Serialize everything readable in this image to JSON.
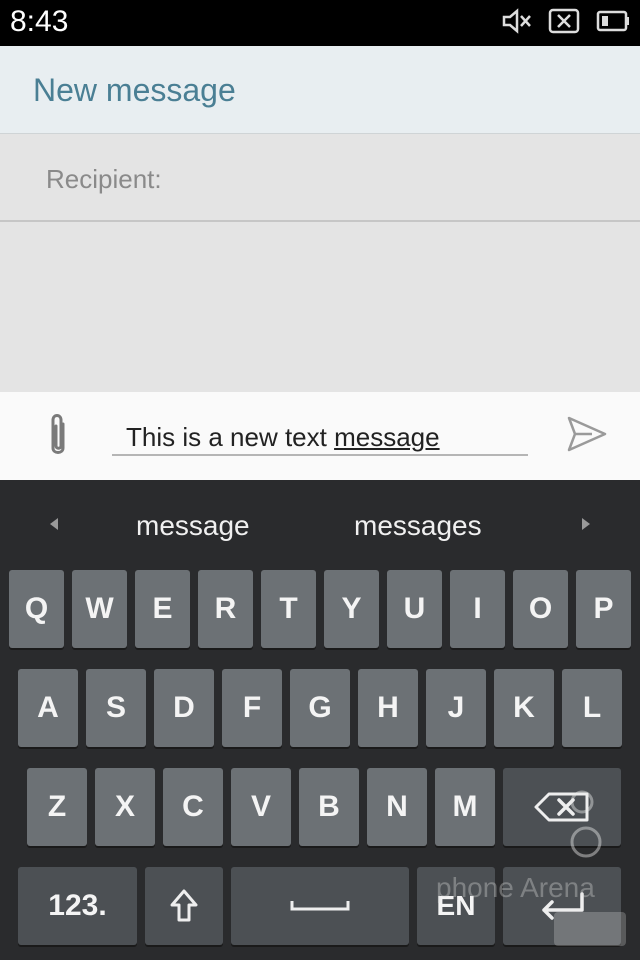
{
  "status_bar": {
    "time": "8:43",
    "icons": [
      "mute-icon",
      "no-signal-icon",
      "battery-icon"
    ]
  },
  "header": {
    "title": "New message"
  },
  "recipient": {
    "label": "Recipient:"
  },
  "compose": {
    "text_before": "This is a new text ",
    "text_underlined": "message",
    "attach_icon": "paperclip-icon",
    "send_icon": "send-icon"
  },
  "keyboard": {
    "suggestions": [
      "message",
      "messages"
    ],
    "row1": [
      "Q",
      "W",
      "E",
      "R",
      "T",
      "Y",
      "U",
      "I",
      "O",
      "P"
    ],
    "row2": [
      "A",
      "S",
      "D",
      "F",
      "G",
      "H",
      "J",
      "K",
      "L"
    ],
    "row3": [
      "Z",
      "X",
      "C",
      "V",
      "B",
      "N",
      "M"
    ],
    "bottom": {
      "numbers": "123.",
      "language": "EN"
    }
  },
  "watermark": {
    "text": "phone Arena"
  },
  "colors": {
    "header_bg": "#e8eef1",
    "title": "#4a7f94",
    "keyboard_bg": "#2a2b2d",
    "key": "#6c7175",
    "fn_key": "#4c5054"
  }
}
